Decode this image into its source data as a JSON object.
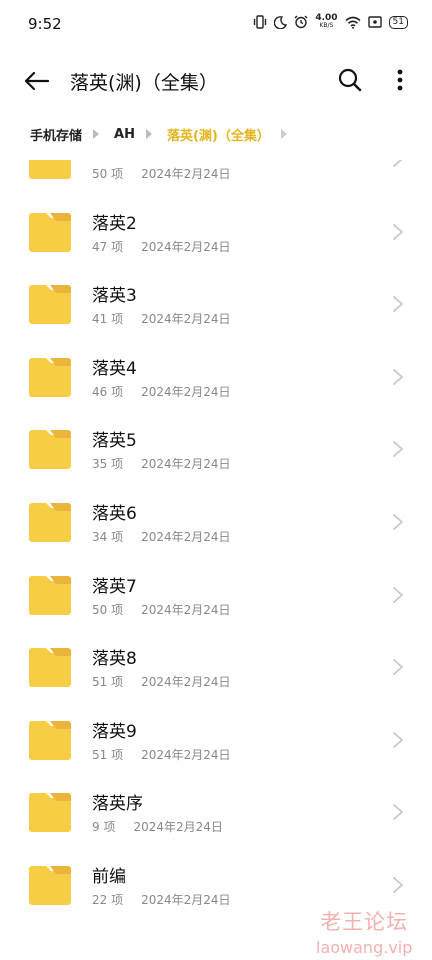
{
  "status_bar": {
    "time": "9:52",
    "net_speed_value": "4.00",
    "net_speed_unit": "KB/S",
    "battery": "51"
  },
  "header": {
    "title": "落英(渊)（全集）",
    "icons": [
      "back-arrow-icon",
      "search-icon",
      "more-vertical-icon"
    ]
  },
  "breadcrumb": [
    "手机存储",
    "AH",
    "落英(渊)（全集）"
  ],
  "folders": [
    {
      "name": "",
      "count": "50 项",
      "date": "2024年2月24日"
    },
    {
      "name": "落英2",
      "count": "47 项",
      "date": "2024年2月24日"
    },
    {
      "name": "落英3",
      "count": "41 项",
      "date": "2024年2月24日"
    },
    {
      "name": "落英4",
      "count": "46 项",
      "date": "2024年2月24日"
    },
    {
      "name": "落英5",
      "count": "35 项",
      "date": "2024年2月24日"
    },
    {
      "name": "落英6",
      "count": "34 项",
      "date": "2024年2月24日"
    },
    {
      "name": "落英7",
      "count": "50 项",
      "date": "2024年2月24日"
    },
    {
      "name": "落英8",
      "count": "51 项",
      "date": "2024年2月24日"
    },
    {
      "name": "落英9",
      "count": "51 项",
      "date": "2024年2月24日"
    },
    {
      "name": "落英序",
      "count": "9 项",
      "date": "2024年2月24日"
    },
    {
      "name": "前编",
      "count": "22 项",
      "date": "2024年2月24日"
    }
  ],
  "watermark": {
    "cn": "老王论坛",
    "en": "laowang.vip"
  },
  "colors": {
    "accent": "#e3b51f",
    "folder": "#f7cd45",
    "folder_tab": "#eab53a"
  }
}
